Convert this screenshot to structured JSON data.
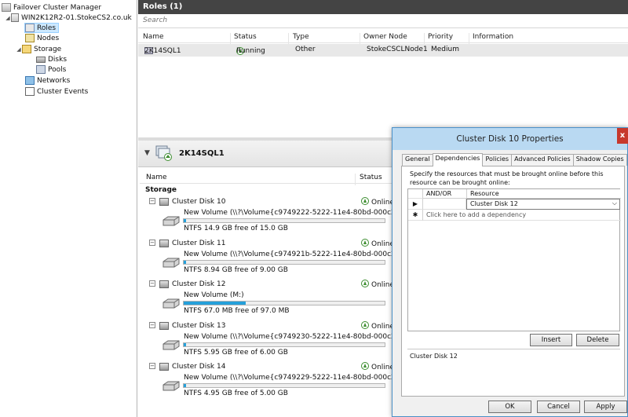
{
  "tree": {
    "root": "Failover Cluster Manager",
    "cluster": "WIN2K12R2-01.StokeCS2.co.uk",
    "roles": "Roles",
    "nodes": "Nodes",
    "storage": "Storage",
    "disks": "Disks",
    "pools": "Pools",
    "networks": "Networks",
    "events": "Cluster Events"
  },
  "roles_pane": {
    "title": "Roles (1)",
    "search_placeholder": "Search",
    "columns": [
      "Name",
      "Status",
      "Type",
      "Owner Node",
      "Priority",
      "Information"
    ],
    "row": {
      "name": "2K14SQL1",
      "status": "Running",
      "type": "Other",
      "owner": "StokeCSCLNode1",
      "priority": "Medium",
      "information": ""
    }
  },
  "detail_pane": {
    "title": "2K14SQL1",
    "columns": [
      "Name",
      "Status"
    ],
    "section": "Storage",
    "disks": [
      {
        "name": "Cluster Disk 10",
        "status": "Online",
        "volume": "New Volume (\\\\?\\Volume{c9749222-5222-11e4-80bd-000c29e96d3b})",
        "free": "NTFS 14.9 GB free of 15.0 GB",
        "used_fraction": 0.01
      },
      {
        "name": "Cluster Disk 11",
        "status": "Online",
        "volume": "New Volume (\\\\?\\Volume{c974921b-5222-11e4-80bd-000c29e96d3b})",
        "free": "NTFS 8.94 GB free of 9.00 GB",
        "used_fraction": 0.01
      },
      {
        "name": "Cluster Disk 12",
        "status": "Online",
        "volume": "New Volume (M:)",
        "free": "NTFS 67.0 MB free of 97.0 MB",
        "used_fraction": 0.31
      },
      {
        "name": "Cluster Disk 13",
        "status": "Online",
        "volume": "New Volume (\\\\?\\Volume{c9749230-5222-11e4-80bd-000c29e96d3b})",
        "free": "NTFS 5.95 GB free of 6.00 GB",
        "used_fraction": 0.01
      },
      {
        "name": "Cluster Disk 14",
        "status": "Online",
        "volume": "New Volume (\\\\?\\Volume{c9749229-5222-11e4-80bd-000c29e96d3b})",
        "free": "NTFS 4.95 GB free of 5.00 GB",
        "used_fraction": 0.01
      }
    ]
  },
  "dialog": {
    "title": "Cluster Disk 10 Properties",
    "close": "x",
    "tabs": [
      "General",
      "Dependencies",
      "Policies",
      "Advanced Policies",
      "Shadow Copies"
    ],
    "active_tab": "Dependencies",
    "description": "Specify the resources that must be brought online before this resource can be brought online:",
    "grid_headers": [
      "AND/OR",
      "Resource"
    ],
    "grid_row_resource": "Cluster Disk 12",
    "add_row_text": "Click here to add a dependency",
    "insert": "Insert",
    "delete": "Delete",
    "summary": "Cluster Disk 12",
    "ok": "OK",
    "cancel": "Cancel",
    "apply": "Apply"
  },
  "colors": {
    "progress_fill": "#26a0da",
    "status_green": "#3c8d2f",
    "title_bar": "#b9d9f2",
    "close_red": "#c7382c"
  }
}
